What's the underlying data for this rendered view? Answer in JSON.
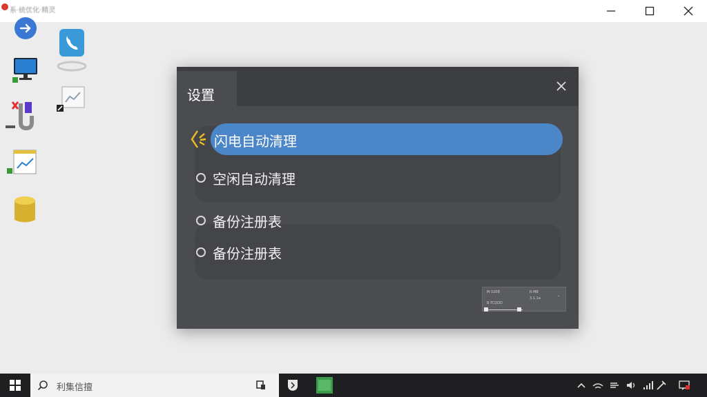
{
  "window": {
    "title": "系·统优化·精灵"
  },
  "dialog": {
    "title": "设置",
    "options": [
      {
        "label": "闪电自动清理",
        "selected": true
      },
      {
        "label": "空闲自动清理",
        "selected": false
      },
      {
        "label": "备份注册表",
        "selected": false
      },
      {
        "label": "备份注册表",
        "selected": false
      }
    ],
    "mini_panel": {
      "t1": "M·320B",
      "t2": "R·MB",
      "t3": "B·TCDDD",
      "t4": "3.1.1a"
    }
  },
  "taskbar": {
    "search_text": "利集信擅"
  },
  "colors": {
    "accent": "#4a86c8",
    "dialog_bg": "#4a4c50",
    "taskbar_bg": "#1f1f21"
  }
}
